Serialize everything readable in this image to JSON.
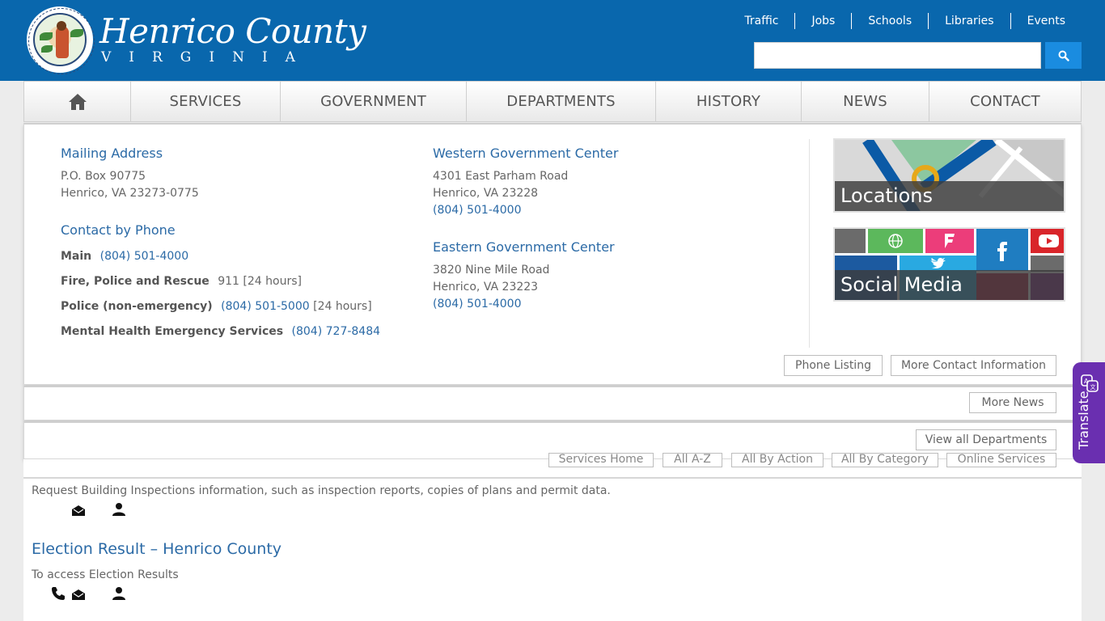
{
  "header": {
    "logo_title": "Henrico County",
    "logo_subtitle": "VIRGINIA",
    "top_links": [
      "Traffic",
      "Jobs",
      "Schools",
      "Libraries",
      "Events"
    ],
    "search_value": ""
  },
  "nav": {
    "items": [
      "SERVICES",
      "GOVERNMENT",
      "DEPARTMENTS",
      "HISTORY",
      "NEWS",
      "CONTACT"
    ]
  },
  "contact": {
    "mailing": {
      "title": "Mailing Address",
      "lines": [
        "P.O. Box 90775",
        "Henrico, VA 23273-0775"
      ]
    },
    "phone": {
      "title": "Contact by Phone",
      "rows": [
        {
          "label": "Main",
          "number": "(804) 501-4000",
          "note": ""
        },
        {
          "label": "Fire, Police and Rescue",
          "number": "911",
          "note": "[24 hours]"
        },
        {
          "label": "Police (non-emergency)",
          "number": "(804) 501-5000",
          "note": "[24 hours]"
        },
        {
          "label": "Mental Health Emergency Services",
          "number": "(804) 727-8484",
          "note": ""
        }
      ]
    },
    "western": {
      "title": "Western Government Center",
      "lines": [
        "4301 East Parham Road",
        "Henrico, VA 23228"
      ],
      "phone": "(804) 501-4000"
    },
    "eastern": {
      "title": "Eastern Government Center",
      "lines": [
        "3820 Nine Mile Road",
        "Henrico, VA 23223"
      ],
      "phone": "(804) 501-4000"
    },
    "tiles": {
      "locations": "Locations",
      "social": "Social Media"
    },
    "buttons": {
      "phone_listing": "Phone Listing",
      "more_contact": "More Contact Information"
    }
  },
  "news": {
    "more_news": "More News"
  },
  "departments": {
    "view_all": "View all Departments"
  },
  "services_buttons": [
    "Services Home",
    "All A-Z",
    "All By Action",
    "All By Category",
    "Online Services"
  ],
  "content": {
    "desc1": "Request Building Inspections information, such as inspection reports, copies of plans and permit data.",
    "result_title": "Election Result – Henrico County",
    "desc2": "To access Election Results"
  },
  "translate": {
    "label": "Translate"
  },
  "colors": {
    "header_blue": "#0967ad",
    "link_blue": "#2b6aa6",
    "translate_purple": "#6a2fb0"
  }
}
